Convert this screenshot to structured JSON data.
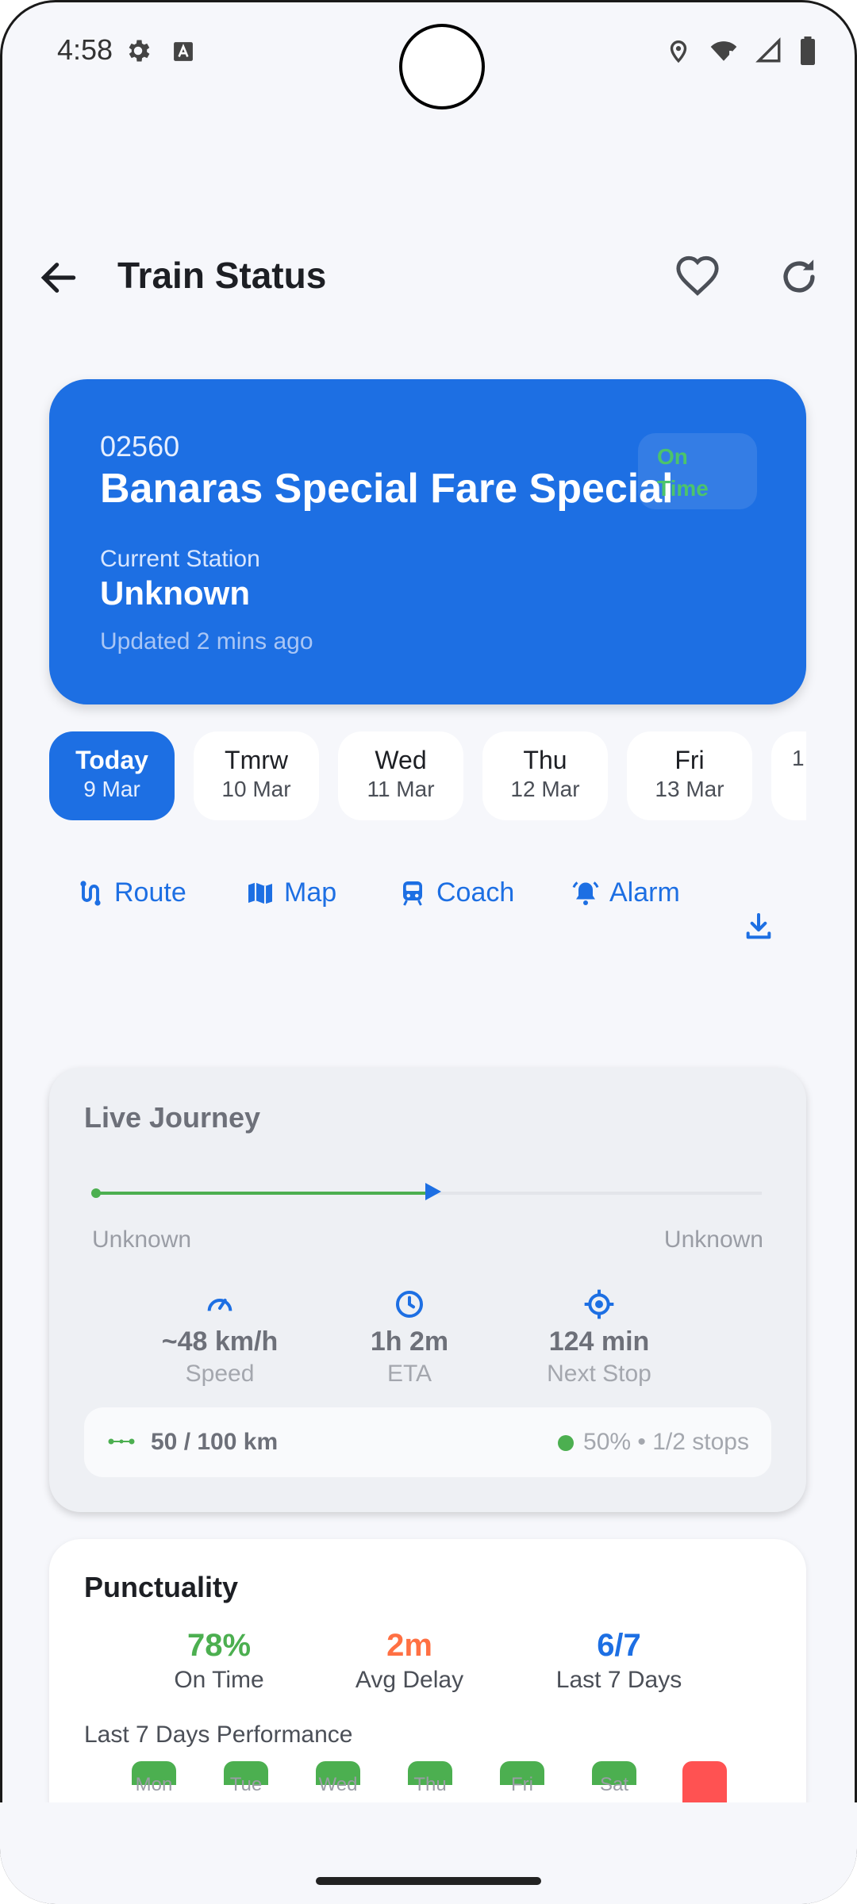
{
  "status_bar": {
    "time": "4:58",
    "icons": [
      "gear-icon",
      "a-icon",
      "location-icon",
      "wifi-icon",
      "signal-icon",
      "battery-icon"
    ]
  },
  "app_bar": {
    "title": "Train Status",
    "back_icon": "arrow-left-icon",
    "favorite_icon": "heart-icon",
    "refresh_icon": "refresh-icon"
  },
  "train": {
    "number": "02560",
    "name": "Banaras Special Fare Special",
    "status_line1": "On",
    "status_line2": "Time",
    "current_station_label": "Current Station",
    "current_station": "Unknown",
    "updated": "Updated 2 mins ago"
  },
  "dates": [
    {
      "day": "Today",
      "date": "9 Mar",
      "selected": true
    },
    {
      "day": "Tmrw",
      "date": "10 Mar",
      "selected": false
    },
    {
      "day": "Wed",
      "date": "11 Mar",
      "selected": false
    },
    {
      "day": "Thu",
      "date": "12 Mar",
      "selected": false
    },
    {
      "day": "Fri",
      "date": "13 Mar",
      "selected": false
    },
    {
      "day": "",
      "date": "1",
      "selected": false
    }
  ],
  "actions": [
    {
      "label": "Route",
      "icon": "route-icon"
    },
    {
      "label": "Map",
      "icon": "map-icon"
    },
    {
      "label": "Coach",
      "icon": "train-icon"
    },
    {
      "label": "Alarm",
      "icon": "alarm-icon"
    }
  ],
  "download_icon": "download-icon",
  "live_journey": {
    "title": "Live Journey",
    "progress": 0.5,
    "from_station": "Unknown",
    "to_station": "Unknown",
    "metrics": [
      {
        "value": "~48 km/h",
        "label": "Speed",
        "icon": "speedometer-icon"
      },
      {
        "value": "1h 2m",
        "label": "ETA",
        "icon": "clock-icon"
      },
      {
        "value": "124 min",
        "label": "Next Stop",
        "icon": "target-icon"
      }
    ],
    "distance": "50 / 100 km",
    "distance_status": "50% • 1/2 stops",
    "colors": {
      "progress": "#4caf50",
      "accent": "#1d6fe3"
    }
  },
  "punctuality": {
    "title": "Punctuality",
    "stats": [
      {
        "value": "78%",
        "label": "On Time",
        "color": "#4caf50"
      },
      {
        "value": "2m",
        "label": "Avg Delay",
        "color": "#ff7043"
      },
      {
        "value": "6/7",
        "label": "Last 7 Days",
        "color": "#1d6fe3"
      }
    ],
    "performance_label": "Last 7 Days Performance",
    "days": [
      {
        "label": "Mon",
        "on_time": true
      },
      {
        "label": "Tue",
        "on_time": true
      },
      {
        "label": "Wed",
        "on_time": true
      },
      {
        "label": "Thu",
        "on_time": true
      },
      {
        "label": "Fri",
        "on_time": true
      },
      {
        "label": "Sat",
        "on_time": true
      },
      {
        "label": "",
        "on_time": false
      }
    ]
  }
}
